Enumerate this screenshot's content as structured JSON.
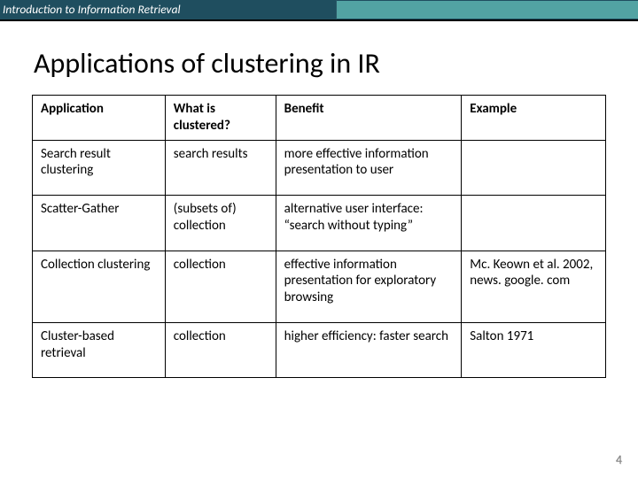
{
  "header": {
    "course": "Introduction to Information Retrieval"
  },
  "title": "Applications of clustering in IR",
  "table": {
    "headers": {
      "c1": "Application",
      "c2": "What is clustered?",
      "c3": "Benefit",
      "c4": "Example"
    },
    "rows": [
      {
        "c1": "Search result clustering",
        "c2": "search results",
        "c3": "more effective information presentation to user",
        "c4": ""
      },
      {
        "c1": "Scatter-Gather",
        "c2": "(subsets of) collection",
        "c3": "alternative user interface: “search without typing”",
        "c4": ""
      },
      {
        "c1": "Collection clustering",
        "c2": "collection",
        "c3": "effective information presentation for exploratory browsing",
        "c4": "Mc. Keown et al. 2002, news. google. com"
      },
      {
        "c1": "Cluster-based retrieval",
        "c2": "collection",
        "c3": "higher efficiency: faster search",
        "c4": "Salton 1971"
      }
    ]
  },
  "page_number": "4"
}
